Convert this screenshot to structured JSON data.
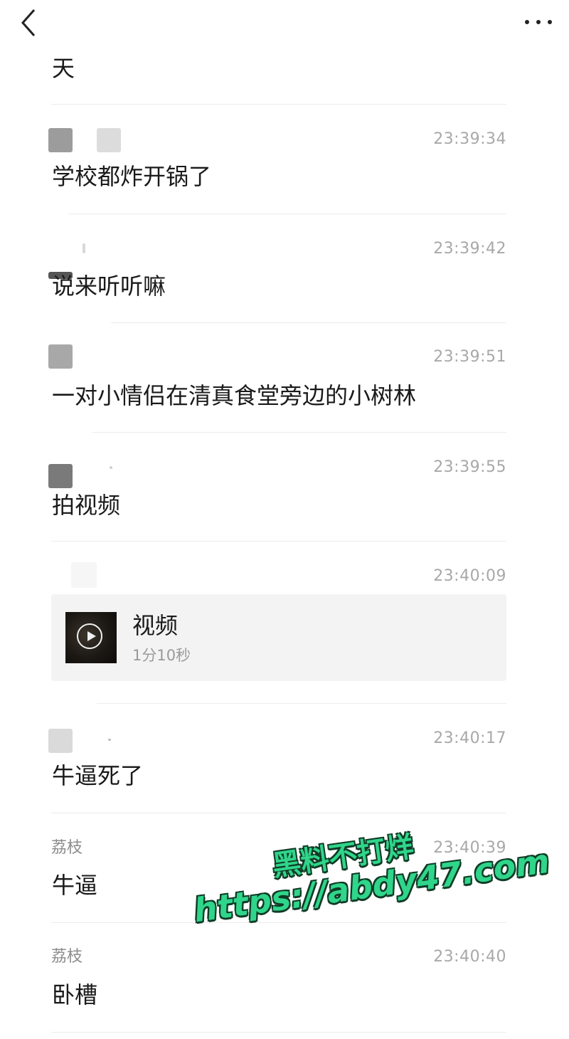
{
  "header": {
    "back_icon": "chevron-left-icon",
    "more_icon": "more-horizontal-icon"
  },
  "messages": [
    {
      "text": "天"
    },
    {
      "time": "23:39:34",
      "text": "学校都炸开锅了"
    },
    {
      "time": "23:39:42",
      "text": "说来听听嘛"
    },
    {
      "time": "23:39:51",
      "text": "一对小情侣在清真食堂旁边的小树林"
    },
    {
      "time": "23:39:55",
      "text": "拍视频"
    },
    {
      "time": "23:40:09",
      "video": {
        "title": "视频",
        "duration": "1分10秒"
      }
    },
    {
      "time": "23:40:17",
      "text": "牛逼死了"
    },
    {
      "sender": "荔枝",
      "time": "23:40:39",
      "text": "牛逼"
    },
    {
      "sender": "荔枝",
      "time": "23:40:40",
      "text": "卧槽"
    }
  ],
  "watermark": {
    "line1": "黑料不打烊",
    "line2": "https://abdy47.com",
    "color": "#2fd58a"
  }
}
